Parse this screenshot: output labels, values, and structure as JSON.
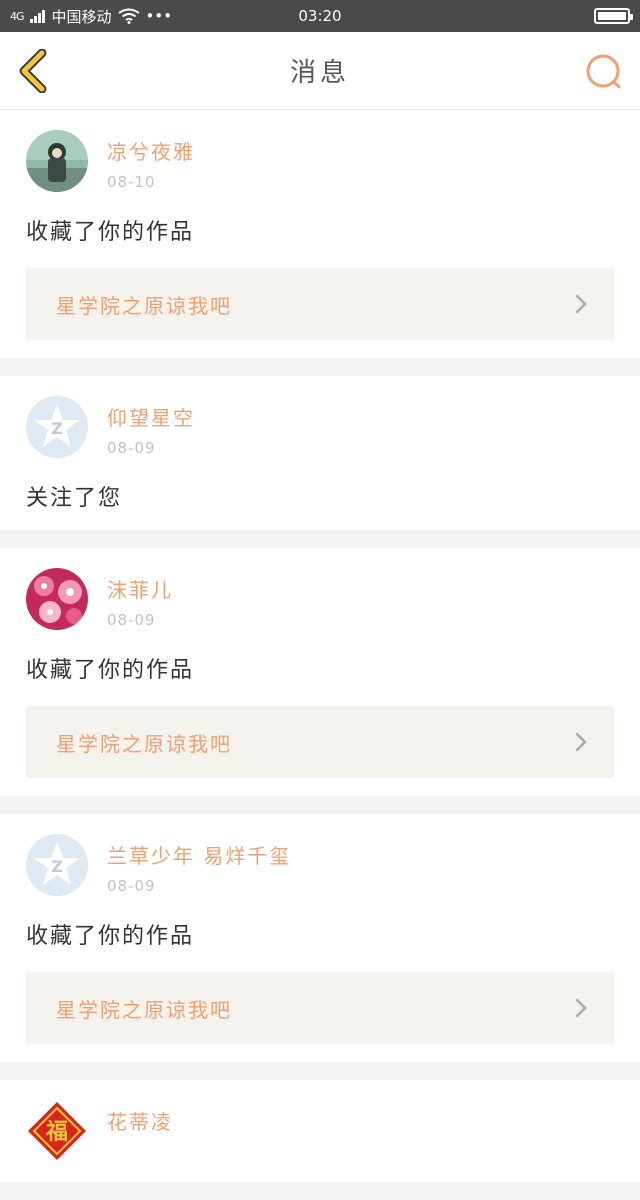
{
  "status_bar": {
    "network": "4G",
    "carrier": "中国移动",
    "dots": "•••",
    "time": "03:20"
  },
  "header": {
    "title": "消息",
    "back_icon": "chevron-left-icon",
    "search_icon": "search-icon"
  },
  "messages": [
    {
      "username": "凉兮夜雅",
      "date": "08-10",
      "text": "收藏了你的作品",
      "work_title": "星学院之原谅我吧",
      "avatar": "photo-girl"
    },
    {
      "username": "仰望星空",
      "date": "08-09",
      "text": "关注了您",
      "work_title": "",
      "avatar": "default-z"
    },
    {
      "username": "沫菲儿",
      "date": "08-09",
      "text": "收藏了你的作品",
      "work_title": "星学院之原谅我吧",
      "avatar": "pink-flowers"
    },
    {
      "username": "兰草少年 易烊千玺",
      "date": "08-09",
      "text": "收藏了你的作品",
      "work_title": "星学院之原谅我吧",
      "avatar": "default-z"
    },
    {
      "username": "花蒂凌",
      "date": "",
      "text": "",
      "work_title": "",
      "avatar": "red-fu"
    }
  ],
  "colors": {
    "accent": "#f0a070",
    "back_icon": "#f3c63d",
    "search_icon": "#f0a070",
    "status_bar": "#4a4a4a"
  }
}
